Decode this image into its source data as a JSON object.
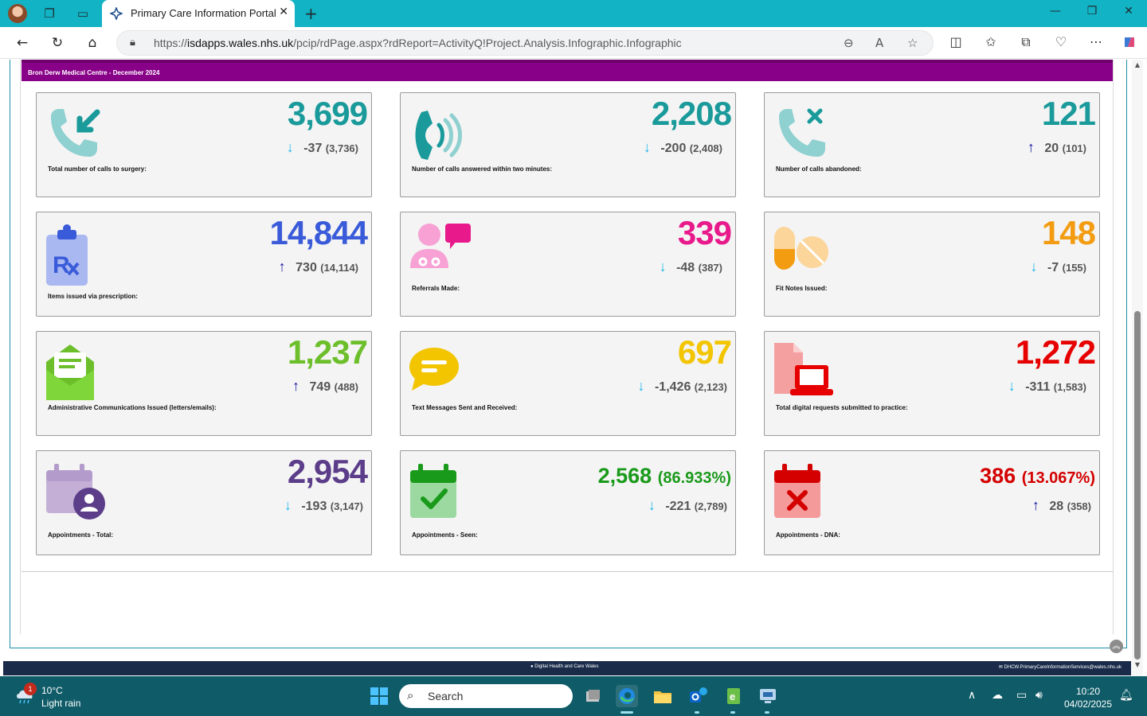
{
  "browser": {
    "tab_title": "Primary Care Information Portal",
    "url_prefix": "https://",
    "url_host": "isdapps.wales.nhs.uk",
    "url_path": "/pcip/rdPage.aspx?rdReport=ActivityQ!Project.Analysis.Infographic.Infographic"
  },
  "report": {
    "header": "Bron Derw Medical Centre - December 2024",
    "cards": [
      {
        "value": "3,699",
        "change": "-37",
        "prev": "(3,736)",
        "direction": "down",
        "label": "Total number of calls to surgery:",
        "color": "#1a9a9a",
        "icon": "phone-incoming-icon"
      },
      {
        "value": "2,208",
        "change": "-200",
        "prev": "(2,408)",
        "direction": "down",
        "label": "Number of calls answered within two minutes:",
        "color": "#1a9a9a",
        "icon": "phone-ringing-icon"
      },
      {
        "value": "121",
        "change": "20",
        "prev": "(101)",
        "direction": "up",
        "label": "Number of calls abandoned:",
        "color": "#1a9a9a",
        "icon": "phone-abandoned-icon"
      },
      {
        "value": "14,844",
        "change": "730",
        "prev": "(14,114)",
        "direction": "up",
        "label": "Items issued via prescription:",
        "color": "#3a5bd9",
        "icon": "prescription-clipboard-icon"
      },
      {
        "value": "339",
        "change": "-48",
        "prev": "(387)",
        "direction": "down",
        "label": "Referrals Made:",
        "color": "#e8198b",
        "icon": "doctor-chat-icon"
      },
      {
        "value": "148",
        "change": "-7",
        "prev": "(155)",
        "direction": "down",
        "label": "Fit Notes Issued:",
        "color": "#f39c12",
        "icon": "pills-icon"
      },
      {
        "value": "1,237",
        "change": "749",
        "prev": "(488)",
        "direction": "up",
        "label": "Administrative Communications Issued (letters/emails):",
        "color": "#6cbf2a",
        "icon": "envelope-open-icon"
      },
      {
        "value": "697",
        "change": "-1,426",
        "prev": "(2,123)",
        "direction": "down",
        "label": "Text Messages Sent and Received:",
        "color": "#f2c500",
        "icon": "speech-bubble-icon"
      },
      {
        "value": "1,272",
        "change": "-311",
        "prev": "(1,583)",
        "direction": "down",
        "label": "Total digital requests submitted to practice:",
        "color": "#e60000",
        "icon": "laptop-document-icon"
      },
      {
        "value": "2,954",
        "change": "-193",
        "prev": "(3,147)",
        "direction": "down",
        "label": "Appointments - Total:",
        "color": "#5c3d8a",
        "icon": "calendar-person-icon"
      },
      {
        "value": "2,568",
        "pct": "(86.933%)",
        "change": "-221",
        "prev": "(2,789)",
        "direction": "down",
        "label": "Appointments - Seen:",
        "color": "#1a9a1a",
        "icon": "calendar-check-icon"
      },
      {
        "value": "386",
        "pct": "(13.067%)",
        "change": "28",
        "prev": "(358)",
        "direction": "up",
        "label": "Appointments - DNA:",
        "color": "#d40000",
        "icon": "calendar-cross-icon"
      }
    ]
  },
  "footer": {
    "center": "Digital Health and Care Wales",
    "right": "DHCW.PrimaryCareInformationServices@wales.nhs.uk"
  },
  "taskbar": {
    "badge_count": "1",
    "temperature": "10°C",
    "weather": "Light rain",
    "search_placeholder": "Search",
    "time": "10:20",
    "date": "04/02/2025"
  }
}
